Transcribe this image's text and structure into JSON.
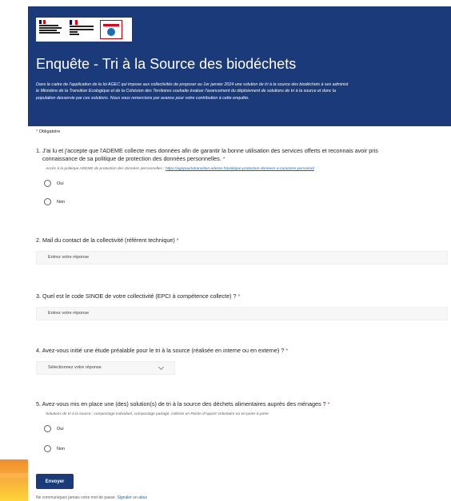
{
  "header": {
    "title": "Enquête - Tri à la Source des biodéchets",
    "description_line1": "Dans le cadre de l'application de la loi AGEC qui impose aux collectivités de proposer au 1er janvier 2024 une solution de tri à la source des biodéchets à ses administ",
    "description_line2": "le Ministère de la Transition Ecologique et de la Cohésion des Territoires souhaite évaluer l'avancement du déploiement de solutions de tri à la source et donc la",
    "description_line3": "population desservie par ces solutions. Nous vous remercions par avance pour votre contribution à cette enquête.",
    "logo_text_ministere": "MINISTÈRE DE LA TRANSITION ÉCOLOGIQUE ET DE LA COHÉSION DES TERRITOIRES",
    "logo_text_republique": "RÉPUBLIQUE FRANÇAISE",
    "logo_text_ademe": "ADEME"
  },
  "form": {
    "required_note": "Obligatoire",
    "required_star": "*",
    "q1": {
      "title_line1": "1. J'ai lu et j'accepte que l'ADEME collecte mes données afin de garantir la bonne utilisation des services offerts et reconnais avoir pris",
      "title_line2": "connaissance de sa politique de protection des données personnelles.",
      "subtitle_prefix": "Accès à la politique ADEME de protection des données personnelles : ",
      "subtitle_link": "https://agirpourlatransition.ademe.fr/politique-protection-donnees-a-caractere-personnel",
      "options": [
        "Oui",
        "Non"
      ]
    },
    "q2": {
      "title": "2. Mail du contact de la collectivité (référent technique)",
      "placeholder": "Entrez votre réponse"
    },
    "q3": {
      "title": "3. Quel est le code SINOE de votre collectivité (EPCI à compétence collecte) ?",
      "placeholder": "Entrez votre réponse"
    },
    "q4": {
      "title": "4. Avez-vous initié une étude préalable pour le tri à la source (réalisée en interne ou en externe) ?",
      "placeholder": "Sélectionnez votre réponse"
    },
    "q5": {
      "title": "5. Avez-vous mis en place une (des) solution(s) de tri à la source des déchets alimentaires auprès des ménages ?",
      "subtitle": "Solutions de tri à la source : compostage individuel, compostage partagé, collecte en Points d'Apport Volontaire ou en porte-à-porte",
      "options": [
        "Oui",
        "Non"
      ]
    },
    "submit_label": "Envoyer",
    "footer_prefix": "Ne communiquez jamais votre mot de passe.",
    "footer_link": "Signaler un abus"
  },
  "colors": {
    "brand_blue": "#1a3a7a",
    "required_red": "#c4314b",
    "link_blue": "#0f6cbd"
  }
}
